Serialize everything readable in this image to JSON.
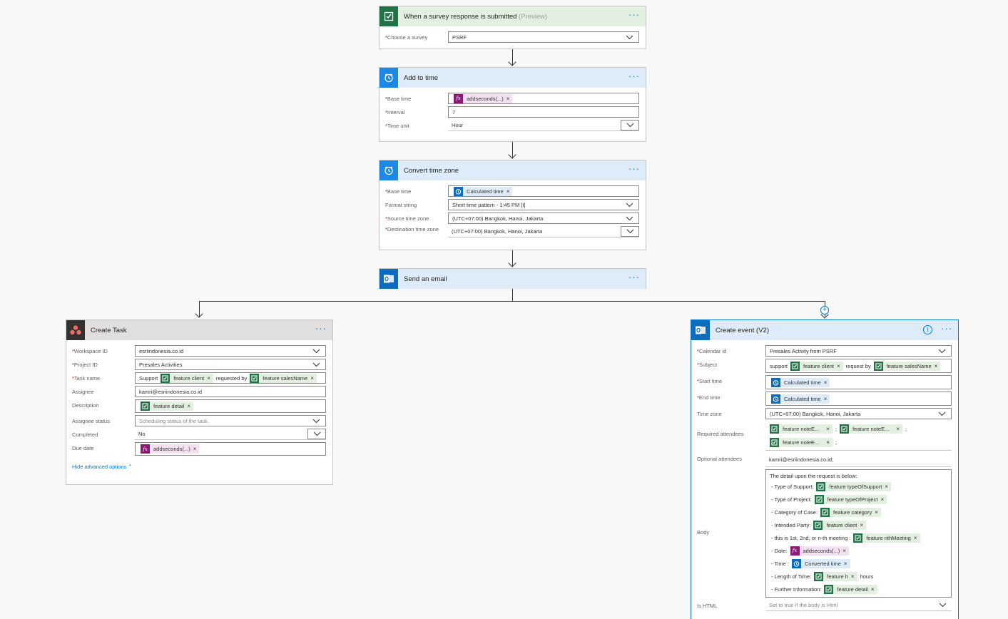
{
  "survey_trigger": {
    "title": "When a survey response is submitted",
    "title_suffix": "(Preview)",
    "choose_survey_label": "Choose a survey",
    "choose_survey_value": "PSRF"
  },
  "add_to_time": {
    "title": "Add to time",
    "base_time_label": "Base time",
    "base_time_token": "addseconds(...)",
    "interval_label": "Interval",
    "interval_value": "7",
    "time_unit_label": "Time unit",
    "time_unit_value": "Hour"
  },
  "convert_time_zone": {
    "title": "Convert time zone",
    "base_time_label": "Base time",
    "base_time_token": "Calculated time",
    "format_label": "Format string",
    "format_value": "Short time pattern - 1:45 PM [t]",
    "source_label": "Source time zone",
    "source_value": "(UTC+07:00) Bangkok, Hanoi, Jakarta",
    "dest_label": "Destination time zone",
    "dest_value": "(UTC+07:00) Bangkok, Hanoi, Jakarta"
  },
  "send_email": {
    "title": "Send an email"
  },
  "create_task": {
    "title": "Create Task",
    "workspace_label": "Workspace ID",
    "workspace_value": "esriindonesia.co.id",
    "project_label": "Project ID",
    "project_value": "Presales Activities",
    "task_name_label": "Task name",
    "task_name_prefix": "Support",
    "task_name_token1": "feature client",
    "task_name_mid": "requested by",
    "task_name_token2": "feature salesName",
    "assignee_label": "Assignee",
    "assignee_value": "kamri@esriindonesia.co.id",
    "description_label": "Description",
    "description_token": "feature detail",
    "assignee_status_label": "Assignee status",
    "assignee_status_placeholder": "Scheduling status of the task.",
    "completed_label": "Completed",
    "completed_value": "No",
    "due_date_label": "Due date",
    "due_date_token": "addseconds(...)",
    "hide_advanced": "Hide advanced options"
  },
  "create_event": {
    "title": "Create event (V2)",
    "calendar_label": "Calendar id",
    "calendar_value": "Presales Activity from PSRF",
    "subject_label": "Subject",
    "subject_prefix": "support",
    "subject_token1": "feature client",
    "subject_mid": "request by",
    "subject_token2": "feature salesName",
    "start_label": "Start time",
    "start_token": "Calculated time",
    "end_label": "End time",
    "end_token": "Calculated time",
    "tz_label": "Time zone",
    "tz_value": "(UTC+07:00) Bangkok, Hanoi, Jakarta",
    "required_label": "Required attendees",
    "required_token1": "feature noteE...",
    "required_token2": "feature noteE...",
    "required_token3": "feature noteE...",
    "semicolon": ";",
    "optional_label": "Optional attendees",
    "optional_value": "kamri@esriindonesia.co.id;",
    "body_label": "Body",
    "body_intro": "The detail upon the request is below:",
    "body_lines": [
      {
        "label": "- Type of Support:",
        "token": "feature typeOfSupport"
      },
      {
        "label": "- Type of Project:",
        "token": "feature typeOfProject"
      },
      {
        "label": "- Category of Case:",
        "token": "feature category"
      },
      {
        "label": "- Intended Party:",
        "token": "feature client"
      },
      {
        "label": "- this is 1st, 2nd, or n-th meeting :",
        "token": "feature nthMeeting"
      },
      {
        "label": "- Date:",
        "token": "addseconds(...)"
      },
      {
        "label": "- Time :",
        "token": "Converted time"
      },
      {
        "label": "- Length of Time:",
        "token": "feature h",
        "suffix": "hours"
      },
      {
        "label": "- Further Information:",
        "token": "feature detail"
      }
    ],
    "is_html_label": "Is HTML",
    "is_html_placeholder": "Set to true if the body is Html"
  },
  "colors": {
    "survey_accent": "#217346",
    "clock_accent": "#1e88e5",
    "outlook_accent": "#0f6cbd",
    "asana_header": "#323130",
    "link": "#0078d4"
  },
  "symbols": {
    "more": "···",
    "remove": "×",
    "required": "*",
    "fx": "fx",
    "info": "i",
    "plus": "+",
    "chevron_up": "^"
  }
}
